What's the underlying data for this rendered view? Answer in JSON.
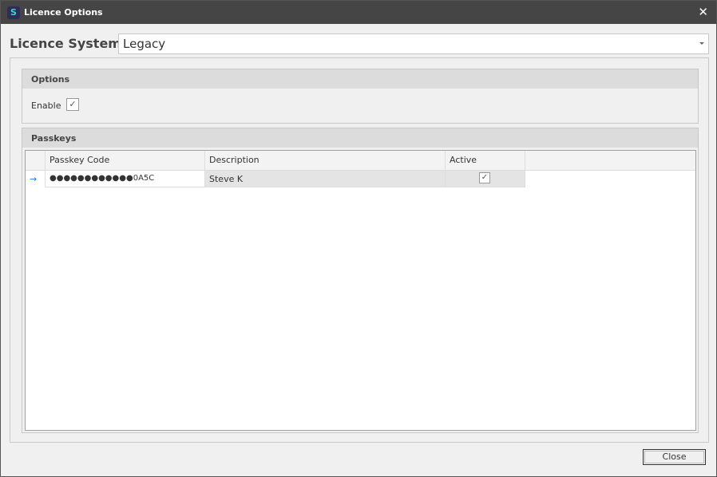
{
  "window": {
    "title": "Licence Options",
    "close_glyph": "✕"
  },
  "licence_system": {
    "label": "Licence System",
    "value": "Legacy"
  },
  "options": {
    "title": "Options",
    "enable_label": "Enable",
    "enable_checked": true
  },
  "passkeys": {
    "title": "Passkeys",
    "columns": [
      "Passkey Code",
      "Description",
      "Active"
    ],
    "rows": [
      {
        "code": "●●●●●●●●●●●●0A5C",
        "description": "Steve K",
        "active": true,
        "current_glyph": "→"
      }
    ]
  },
  "footer": {
    "close_label": "Close"
  },
  "colors": {
    "titlebar": "#454545",
    "accent_arrow": "#1e78d7"
  }
}
